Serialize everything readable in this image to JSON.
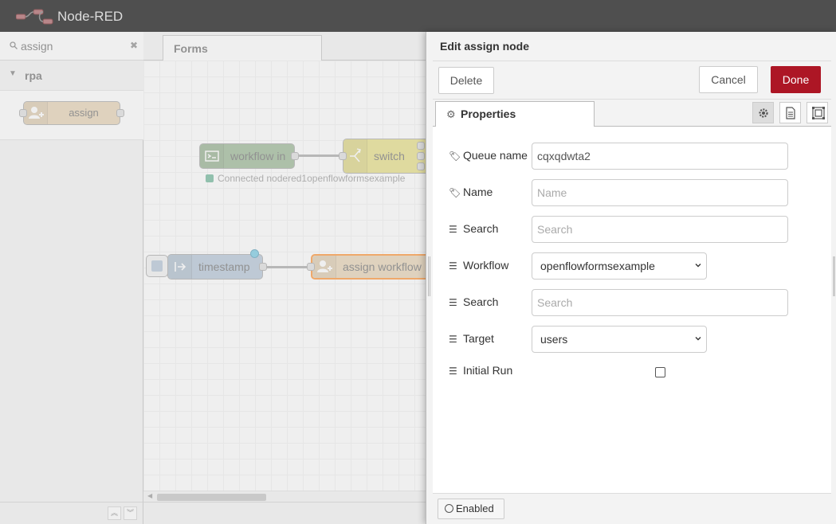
{
  "app": {
    "title": "Node-RED"
  },
  "palette": {
    "search_value": "assign",
    "category": "rpa",
    "nodes": [
      {
        "label": "assign"
      }
    ]
  },
  "workspace": {
    "tab_label": "Forms",
    "nodes": {
      "workflow_in": "workflow in",
      "switch": "switch",
      "timestamp": "timestamp",
      "assign_workflow": "assign workflow"
    },
    "status_text": "Connected nodered1openflowformsexample"
  },
  "tray": {
    "title": "Edit assign node",
    "delete_label": "Delete",
    "cancel_label": "Cancel",
    "done_label": "Done",
    "properties_tab": "Properties",
    "fields": {
      "queue_name": {
        "label": "Queue name",
        "value": "cqxqdwta2"
      },
      "name": {
        "label": "Name",
        "placeholder": "Name"
      },
      "search1": {
        "label": "Search",
        "placeholder": "Search"
      },
      "workflow": {
        "label": "Workflow",
        "value": "openflowformsexample"
      },
      "search2": {
        "label": "Search",
        "placeholder": "Search"
      },
      "target": {
        "label": "Target",
        "value": "users"
      },
      "initial_run": {
        "label": "Initial Run",
        "checked": false
      }
    },
    "enabled_label": "Enabled"
  },
  "colors": {
    "header": "#4f4f4f",
    "done_button": "#ad1625",
    "assign_node": "#e2cba6",
    "workflow_in_node": "#87a980",
    "switch_node": "#e2d96e",
    "timestamp_node": "#a6bbcf",
    "selected_outline": "#ff7f0e"
  }
}
